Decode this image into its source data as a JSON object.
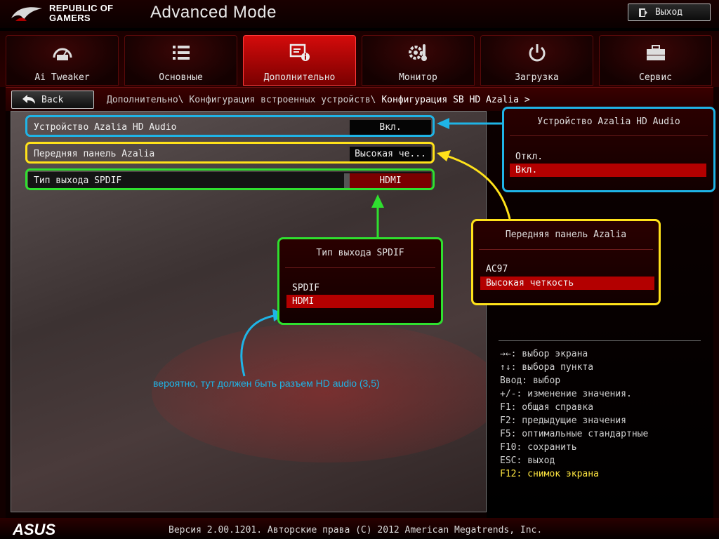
{
  "header": {
    "logo_line1": "REPUBLIC OF",
    "logo_line2": "GAMERS",
    "mode": "Advanced Mode",
    "exit_label": "Выход"
  },
  "tabs": [
    {
      "label": "Ai Tweaker",
      "icon": "gauge-icon",
      "active": false
    },
    {
      "label": "Основные",
      "icon": "list-icon",
      "active": false
    },
    {
      "label": "Дополнительно",
      "icon": "advanced-info-icon",
      "active": true
    },
    {
      "label": "Монитор",
      "icon": "thermometer-gear-icon",
      "active": false
    },
    {
      "label": "Загрузка",
      "icon": "power-icon",
      "active": false
    },
    {
      "label": "Сервис",
      "icon": "toolbox-icon",
      "active": false
    }
  ],
  "breadcrumb": {
    "back_label": "Back",
    "path": "Дополнительно\\ Конфигурация встроенных устройств\\ ",
    "current": "Конфигурация SB HD Azalia >"
  },
  "settings": [
    {
      "label": "Устройство Azalia HD Audio",
      "value": "Вкл."
    },
    {
      "label": "Передняя панель Azalia",
      "value": "Высокая че..."
    },
    {
      "label": "Тип выхода SPDIF",
      "value": "HDMI"
    }
  ],
  "popups": {
    "azalia_device": {
      "title": "Устройство Azalia HD Audio",
      "options": [
        "Откл.",
        "Вкл."
      ],
      "selected": 1
    },
    "front_panel": {
      "title": "Передняя панель Azalia",
      "options": [
        "AC97",
        "Высокая четкость"
      ],
      "selected": 1
    },
    "spdif": {
      "title": "Тип выхода SPDIF",
      "options": [
        "SPDIF",
        "HDMI"
      ],
      "selected": 1
    }
  },
  "annotation_note": "вероятно, тут должен быть разъем HD audio (3,5)",
  "annotation_colors": {
    "cyan": "#1fb4e6",
    "yellow": "#ffe21a",
    "green": "#2fe02f"
  },
  "help": [
    "→←: выбор экрана",
    "↑↓: выбора пункта",
    "Ввод: выбор",
    "+/-: изменение значения.",
    "F1: общая справка",
    "F2: предыдущие значения",
    "F5: оптимальные стандартные",
    "F10: сохранить",
    "ESC: выход",
    "F12: снимок экрана"
  ],
  "footer": {
    "brand": "ASUS",
    "version": "Версия 2.00.1201. Авторские права (C) 2012 American Megatrends, Inc."
  }
}
